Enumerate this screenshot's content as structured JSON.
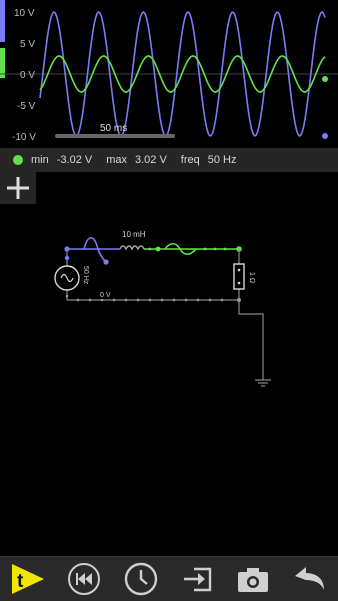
{
  "scope": {
    "y_labels": [
      "10 V",
      "5 V",
      "0 V",
      "-5 V",
      "-10 V"
    ],
    "timebase": "50 ms",
    "colors": {
      "voltage": "#7b7cf5",
      "current": "#62e24b",
      "grid": "#555555"
    }
  },
  "readout": {
    "min_label": "min",
    "min_value": "-3.02 V",
    "max_label": "max",
    "max_value": "3.02 V",
    "freq_label": "freq",
    "freq_value": "50 Hz",
    "indicator_color": "#62e24b"
  },
  "circuit": {
    "source_label": "50 Hz",
    "inductor_label": "10 mH",
    "resistor_label": "1 Ω",
    "ground_node_label": "0 V"
  },
  "toolbar": {
    "icons": [
      "tool-menu-icon",
      "rewind-icon",
      "clock-icon",
      "import-icon",
      "camera-icon",
      "undo-icon"
    ]
  }
}
